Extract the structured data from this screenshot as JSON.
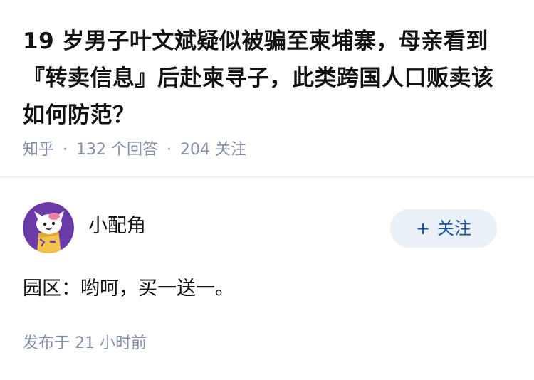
{
  "question": {
    "title": "19 岁男子叶文斌疑似被骗至柬埔寨，母亲看到『转卖信息』后赴柬寻子，此类跨国人口贩卖该如何防范？",
    "source": "知乎",
    "separator": "·",
    "answer_count": "132 个回答",
    "follower_count": "204 关注"
  },
  "answer": {
    "author": {
      "name": "小配角",
      "avatar_icon": "cartoon-character-avatar"
    },
    "follow_button": {
      "plus": "+",
      "label": "关注"
    },
    "content": "园区：哟呵，买一送一。",
    "time": "发布于 21 小时前"
  },
  "colors": {
    "title_text": "#121212",
    "meta_text": "#8590a6",
    "follow_bg": "#eaf0f8",
    "follow_text": "#175199",
    "avatar_bg": "#6a3aa8"
  }
}
